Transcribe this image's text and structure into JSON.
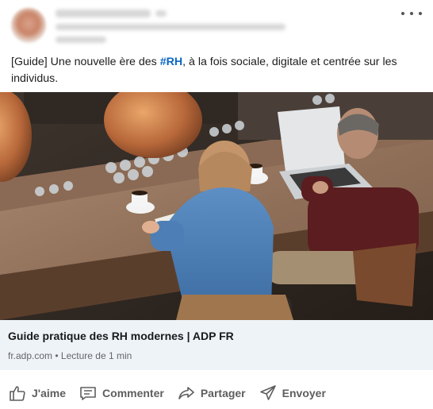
{
  "post": {
    "text_prefix": "[Guide] Une nouvelle ère des ",
    "hashtag": "#RH",
    "text_suffix": ", à la fois sociale, digitale et centrée sur les individus."
  },
  "link_card": {
    "title": "Guide pratique des RH modernes | ADP FR",
    "domain": "fr.adp.com",
    "separator": " • ",
    "read_time": "Lecture de 1 min"
  },
  "actions": {
    "like_label": "J'aime",
    "comment_label": "Commenter",
    "share_label": "Partager",
    "send_label": "Envoyer"
  },
  "icons": {
    "more": "more-horizontal-icon",
    "like": "thumbs-up-icon",
    "comment": "comment-icon",
    "share": "share-arrow-icon",
    "send": "send-paper-plane-icon"
  },
  "colors": {
    "hashtag": "#0a66c2",
    "link_card_bg": "#eef3f8",
    "action_text": "#5e5e5e"
  }
}
